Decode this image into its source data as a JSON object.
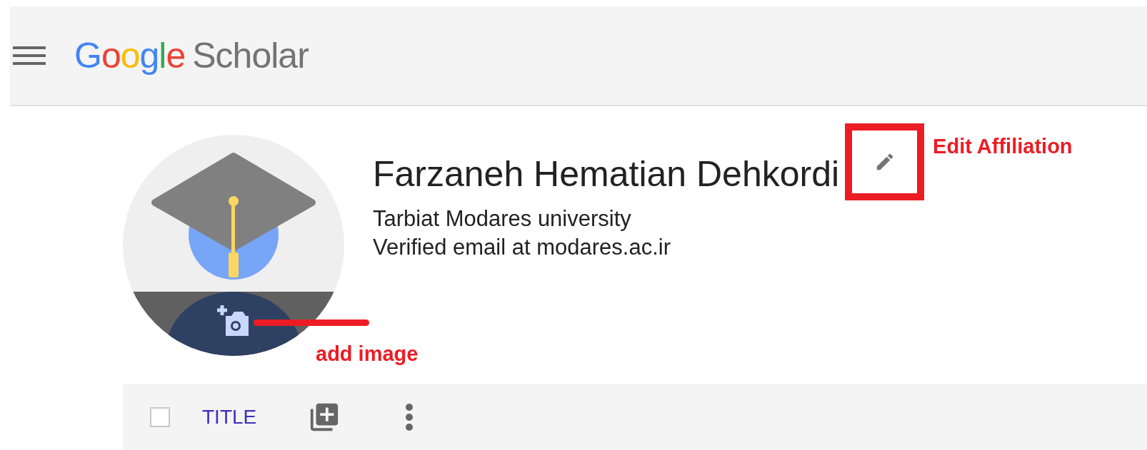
{
  "header": {
    "logo": {
      "brand": "Google",
      "product": "Scholar"
    }
  },
  "profile": {
    "name": "Farzaneh Hematian Dehkordi",
    "affiliation": "Tarbiat Modares university",
    "email": "Verified email at modares.ac.ir"
  },
  "annotations": {
    "edit_label": "Edit Affiliation",
    "image_label": "add image"
  },
  "table_header": {
    "checkbox": {
      "checked": false
    },
    "columns": [
      {
        "label": "TITLE"
      }
    ]
  }
}
